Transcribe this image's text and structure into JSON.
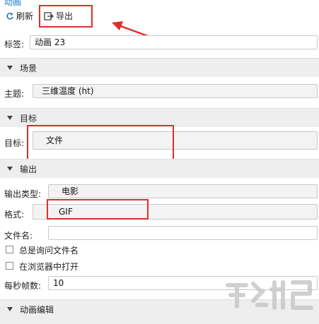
{
  "header": {
    "title": "动画"
  },
  "toolbar": {
    "refresh_label": "刷新",
    "export_label": "导出"
  },
  "tag": {
    "label": "标签:",
    "value": "动画 23"
  },
  "sections": {
    "scene": "场景",
    "target": "目标",
    "output": "输出",
    "edit": "动画编辑"
  },
  "scene": {
    "subject_label": "主题:",
    "subject_value": "三维温度 (ht)"
  },
  "target": {
    "label": "目标:",
    "value": "文件"
  },
  "output": {
    "type_label": "输出类型:",
    "type_value": "电影",
    "format_label": "格式:",
    "format_value": "GIF",
    "filename_label": "文件名:",
    "filename_value": "",
    "always_ask_label": "总是询问文件名",
    "open_browser_label": "在浏览器中打开",
    "fps_label": "每秒帧数:",
    "fps_value": "10"
  },
  "annotation_color": "#e52b2b"
}
